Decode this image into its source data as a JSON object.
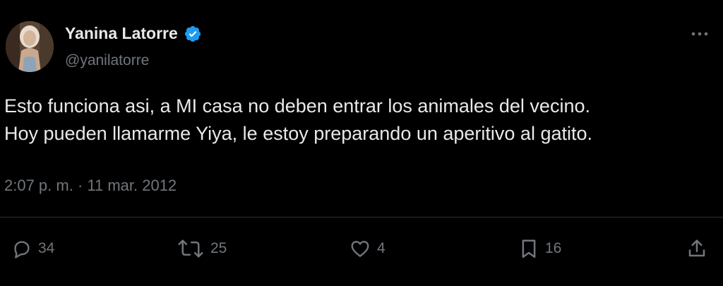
{
  "author": {
    "display_name": "Yanina Latorre",
    "handle": "@yanilatorre",
    "verified": true,
    "verified_color": "#1d9bf0"
  },
  "tweet": {
    "lines": [
      "Esto funciona asi, a MI casa no deben entrar los animales del vecino.",
      "Hoy pueden llamarme Yiya, le estoy preparando un aperitivo al gatito."
    ],
    "timestamp": "2:07 p. m. · 11 mar. 2012"
  },
  "actions": {
    "replies": "34",
    "retweets": "25",
    "likes": "4",
    "bookmarks": "16"
  },
  "colors": {
    "background": "#000000",
    "text": "#e7e9ea",
    "secondary_text": "#71767b",
    "divider": "#2f3336"
  },
  "icons": {
    "more": "more-dots-icon",
    "reply": "reply-bubble-icon",
    "retweet": "retweet-arrows-icon",
    "like": "heart-icon",
    "bookmark": "bookmark-icon",
    "share": "share-upload-icon"
  }
}
